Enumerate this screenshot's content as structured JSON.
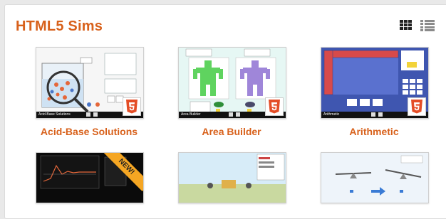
{
  "section": {
    "title": "HTML5 Sims",
    "view_icons": [
      "grid-view-icon",
      "list-view-icon"
    ]
  },
  "colors": {
    "accent": "#d8611b",
    "html5_badge": "#e44d26"
  },
  "sims": [
    {
      "label": "Acid-Base Solutions",
      "caption": "Acid-Base Solutions",
      "badge": "html5-icon"
    },
    {
      "label": "Area Builder",
      "caption": "Area Builder",
      "badge": "html5-icon"
    },
    {
      "label": "Arithmetic",
      "caption": "Arithmetic",
      "badge": "html5-icon"
    }
  ],
  "second_row": {
    "ribbon": "NEW!"
  }
}
